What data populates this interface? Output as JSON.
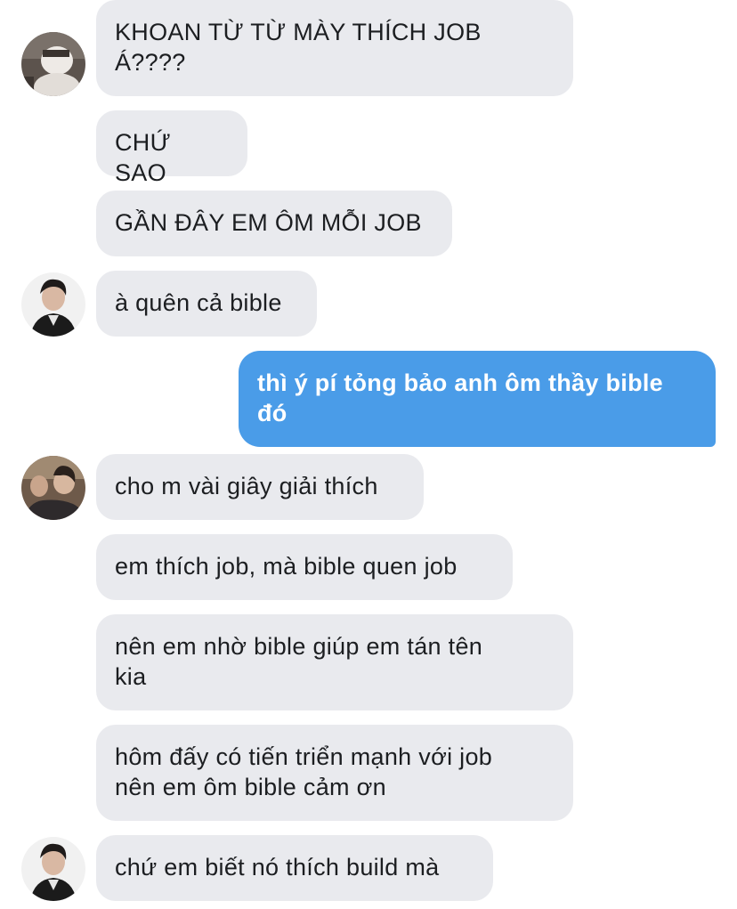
{
  "conversation": {
    "messages": [
      {
        "text": "KHOAN TỪ TỪ MÀY THÍCH JOB\nÁ????",
        "direction": "incoming"
      },
      {
        "text": "CHỨ SAO",
        "direction": "incoming"
      },
      {
        "text": "GẦN ĐÂY EM ÔM MỖI JOB",
        "direction": "incoming"
      },
      {
        "text": "à quên cả bible",
        "direction": "incoming"
      },
      {
        "text": "thì ý pí tỏng bảo anh ôm thầy bible\nđó",
        "direction": "outgoing"
      },
      {
        "text": "cho m vài giây giải thích",
        "direction": "incoming"
      },
      {
        "text": "em thích job, mà bible quen job",
        "direction": "incoming"
      },
      {
        "text": "nên em nhờ bible giúp em tán tên\nkia",
        "direction": "incoming"
      },
      {
        "text": "hôm đấy có tiến triển mạnh với job\nnên em ôm bible cảm ơn",
        "direction": "incoming"
      },
      {
        "text": "chứ em biết nó thích build mà",
        "direction": "incoming"
      }
    ]
  },
  "colors": {
    "incoming_bubble": "#e9eaee",
    "outgoing_bubble": "#4a9ce8",
    "incoming_text": "#1c1e21",
    "outgoing_text": "#ffffff"
  }
}
